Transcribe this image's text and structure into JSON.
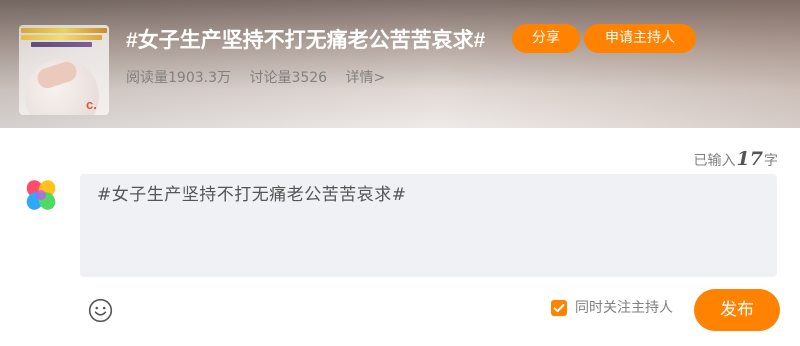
{
  "topic": {
    "title": "#女子生产坚持不打无痛老公苦苦哀求#",
    "share_label": "分享",
    "apply_host_label": "申请主持人",
    "read_count": "阅读量1903.3万",
    "discussion_count": "讨论量3526",
    "details_label": "详情>"
  },
  "composer": {
    "counter_prefix": "已输入",
    "counter_value": "17",
    "counter_suffix": "字",
    "text": "#女子生产坚持不打无痛老公苦苦哀求#",
    "follow_host_label": "同时关注主持人",
    "follow_host_checked": true,
    "publish_label": "发布"
  },
  "colors": {
    "accent": "#ff8200",
    "muted_text": "#808080",
    "input_bg": "#f0f1f4"
  },
  "icons": {
    "logo": "colorful-clover-icon",
    "emoji": "smiley-face-icon",
    "checkbox": "checkmark-icon"
  }
}
